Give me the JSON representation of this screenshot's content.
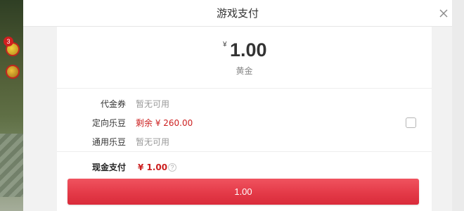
{
  "dialog": {
    "title": "游戏支付",
    "close_icon": "close-icon"
  },
  "order": {
    "currency_symbol": "¥",
    "amount": "1.00",
    "product_name": "黄金"
  },
  "payment_options": [
    {
      "label": "代金券",
      "value": "暂无可用",
      "value_style": "muted"
    },
    {
      "label": "定向乐豆",
      "value": "剩余 ¥ 260.00",
      "value_style": "red",
      "has_checkbox": true,
      "checked": false
    },
    {
      "label": "通用乐豆",
      "value": "暂无可用",
      "value_style": "muted"
    }
  ],
  "cash": {
    "label": "现金支付",
    "value": "¥ 1.00",
    "help_icon_text": "?"
  },
  "pay_button": {
    "label": "1.00"
  },
  "game_overlay": {
    "badge_count": "3"
  },
  "colors": {
    "accent_red": "#e43a48",
    "text_red": "#cc1f1f",
    "muted_text": "#999999",
    "background": "#f2f2f2"
  }
}
